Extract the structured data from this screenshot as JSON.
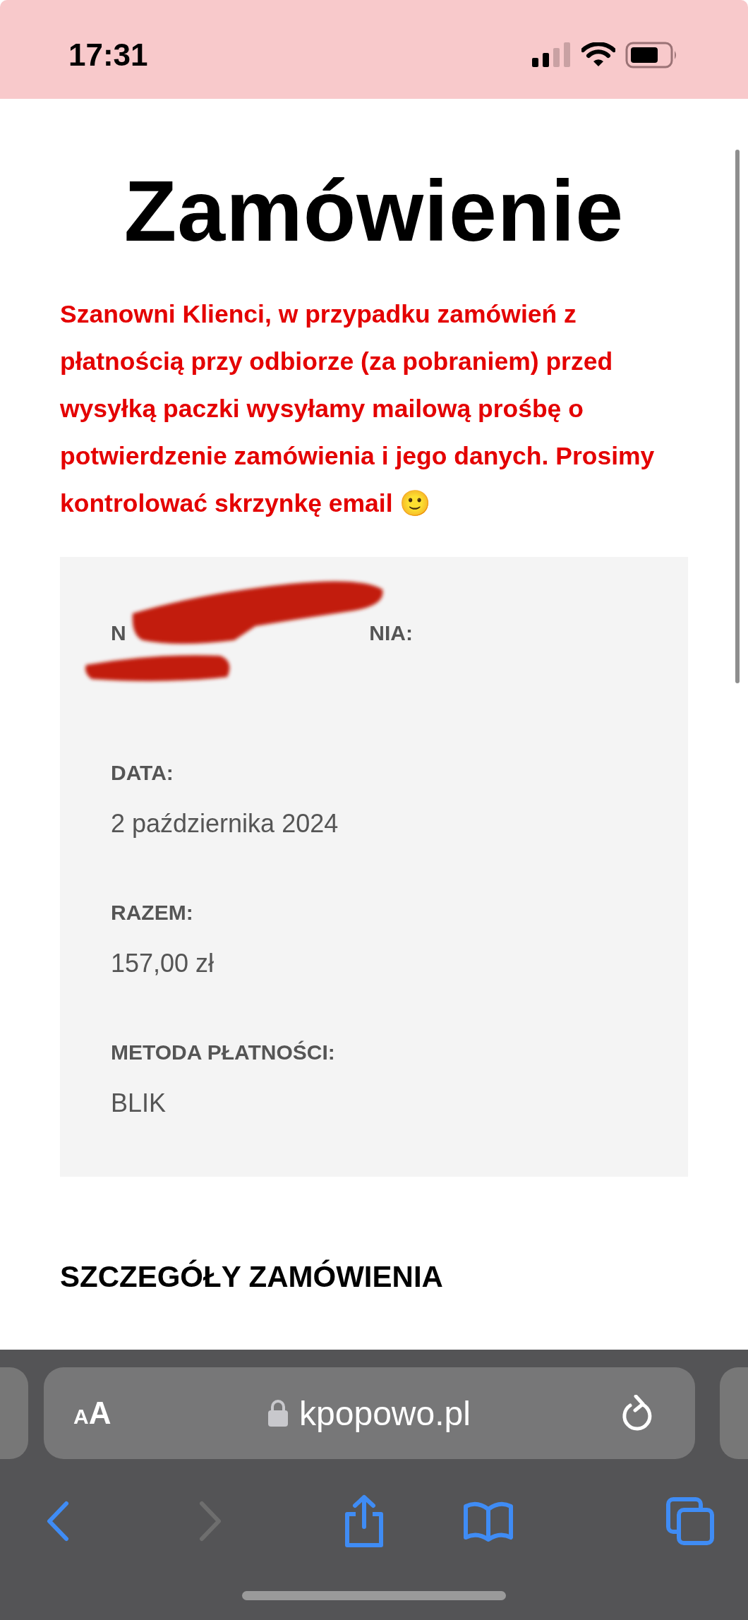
{
  "status_bar": {
    "time": "17:31"
  },
  "page": {
    "title": "Zamówienie",
    "notice": "Szanowni Klienci, w przypadku zamówień z płatnością przy odbiorze (za pobraniem) przed wysyłką paczki wysyłamy mailową prośbę o potwierdzenie zamówienia i jego danych. Prosimy kontrolować skrzynkę email 🙂",
    "order_summary": [
      {
        "kind": "redacted",
        "label_parts": [
          "N",
          "NIA:"
        ]
      },
      {
        "kind": "field",
        "label": "DATA:",
        "value": "2 października 2024"
      },
      {
        "kind": "field",
        "label": "RAZEM:",
        "value": "157,00 zł"
      },
      {
        "kind": "field",
        "label": "METODA PŁATNOŚCI:",
        "value": "BLIK"
      }
    ],
    "section_heading": "SZCZEGÓŁY ZAMÓWIENIA"
  },
  "browser": {
    "text_size_button": "AA",
    "url": "kpopowo.pl",
    "forward_disabled": true
  }
}
